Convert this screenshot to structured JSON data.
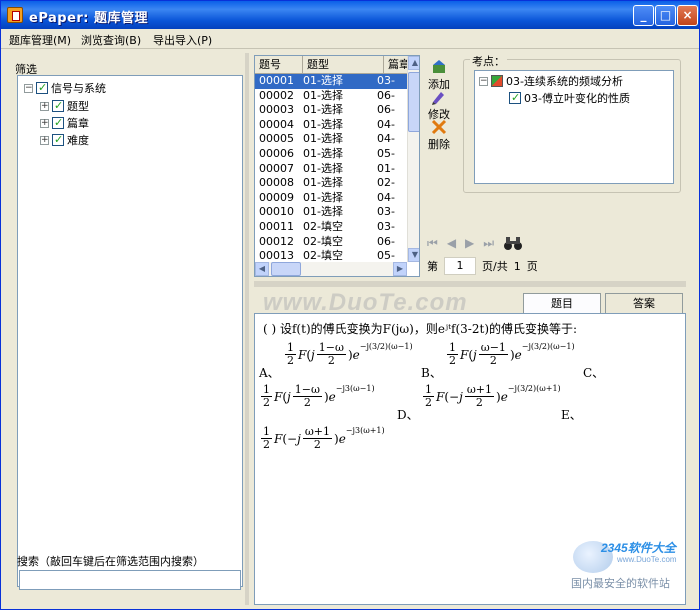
{
  "window": {
    "title": "ePaper: 题库管理",
    "controls": [
      "_",
      "□",
      "×"
    ]
  },
  "menu": [
    "题库管理(M)",
    "浏览查询(B)",
    "导出导入(P)"
  ],
  "filter": {
    "label": "筛选",
    "root": "信号与系统",
    "children": [
      "题型",
      "篇章",
      "难度"
    ],
    "search_label": "搜索（敲回车键后在筛选范围内搜索）",
    "search_value": ""
  },
  "table": {
    "headers": [
      "题号",
      "题型",
      "篇章"
    ],
    "rows": [
      [
        "00001",
        "01-选择",
        "03-"
      ],
      [
        "00002",
        "01-选择",
        "06-"
      ],
      [
        "00003",
        "01-选择",
        "06-"
      ],
      [
        "00004",
        "01-选择",
        "04-"
      ],
      [
        "00005",
        "01-选择",
        "04-"
      ],
      [
        "00006",
        "01-选择",
        "05-"
      ],
      [
        "00007",
        "01-选择",
        "01-"
      ],
      [
        "00008",
        "01-选择",
        "02-"
      ],
      [
        "00009",
        "01-选择",
        "04-"
      ],
      [
        "00010",
        "01-选择",
        "03-"
      ],
      [
        "00011",
        "02-填空",
        "03-"
      ],
      [
        "00012",
        "02-填空",
        "06-"
      ],
      [
        "00013",
        "02-填空",
        "05-"
      ]
    ],
    "selected_index": 0
  },
  "tools": {
    "add": "添加",
    "edit": "修改",
    "delete": "删除"
  },
  "knowledge": {
    "label": "考点：",
    "parent": "03-连续系统的频域分析",
    "child": "03-傅立叶变化的性质"
  },
  "pager": {
    "prefix": "第",
    "page": "1",
    "middle": "页/共",
    "total": "1",
    "suffix": "页"
  },
  "tabs": {
    "question": "题目",
    "answer": "答案"
  },
  "question": {
    "text": "(    )    设f(t)的傅氏变换为F(jω)，则eʲᵗf(3-2t)的傅氏变换等于:",
    "options": [
      "A、",
      "B、",
      "C、",
      "D、",
      "E、"
    ]
  },
  "watermarks": {
    "site": "www.DuoTe.com",
    "logo_top": "2345软件大全",
    "logo_url": "www.DuoTe.com",
    "logo_bottom": "国内最安全的软件站"
  },
  "colors": {
    "title_bar": "#0a55d8",
    "selection": "#316ac5",
    "window_bg": "#ece9d8"
  }
}
